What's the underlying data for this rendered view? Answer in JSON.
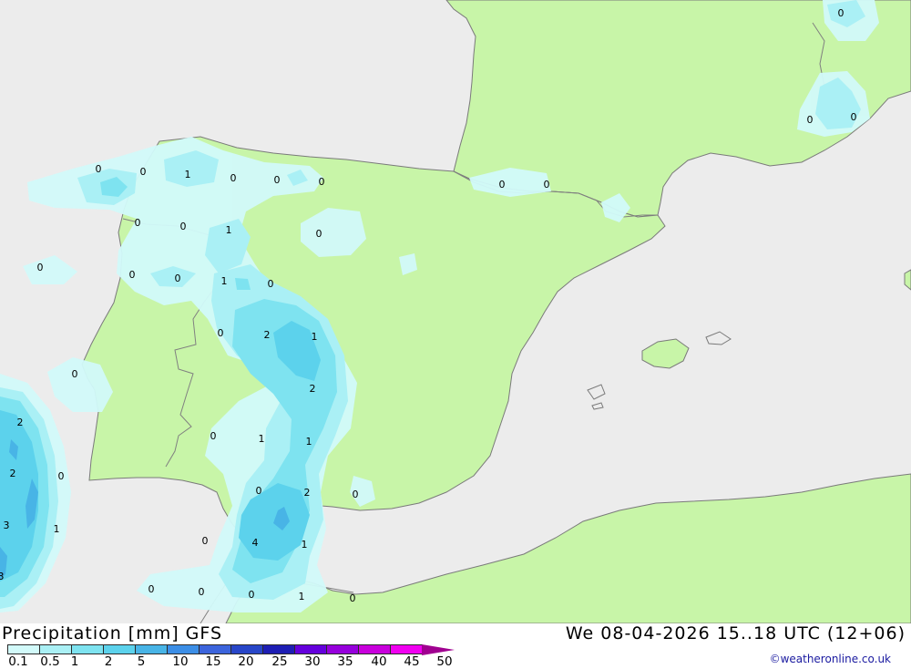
{
  "map": {
    "colors": {
      "sea": "#ececec",
      "land": "#c8f5a8",
      "coast": "#7a7a7a",
      "border": "#808080",
      "precip_0_1": "#d2fafa",
      "precip_0_5": "#aaf0f5",
      "precip_1": "#7ee3f0",
      "precip_2": "#5cd2ec",
      "precip_5": "#48b4e6"
    },
    "contour_labels": [
      "0",
      "0",
      "1",
      "0",
      "0",
      "0",
      "0",
      "0",
      "0",
      "0",
      "0",
      "0",
      "1",
      "0",
      "0",
      "0",
      "0",
      "0",
      "1",
      "0",
      "0",
      "2",
      "1",
      "2",
      "0",
      "0",
      "1",
      "0",
      "1",
      "2",
      "0",
      "0",
      "4",
      "1",
      "0",
      "0",
      "0",
      "1",
      "0",
      "2",
      "2",
      "0",
      "3",
      "1",
      "3"
    ]
  },
  "footer": {
    "title": "Precipitation [mm] GFS",
    "valid_time": "We 08-04-2026 15..18 UTC (12+06)",
    "credit": "©weatheronline.co.uk"
  },
  "legend": {
    "labels": [
      "0.1",
      "0.5",
      "1",
      "2",
      "5",
      "10",
      "15",
      "20",
      "25",
      "30",
      "35",
      "40",
      "45",
      "50"
    ],
    "colors": [
      "#d2fafa",
      "#aaf0f5",
      "#7ee3f0",
      "#5cd2ec",
      "#48b4e6",
      "#3c8ee6",
      "#3c64dc",
      "#2846c8",
      "#1e1eb4",
      "#6400dc",
      "#9600dc",
      "#c800dc",
      "#f000f0",
      "#c000c0"
    ],
    "arrow_color": "#a00090"
  }
}
